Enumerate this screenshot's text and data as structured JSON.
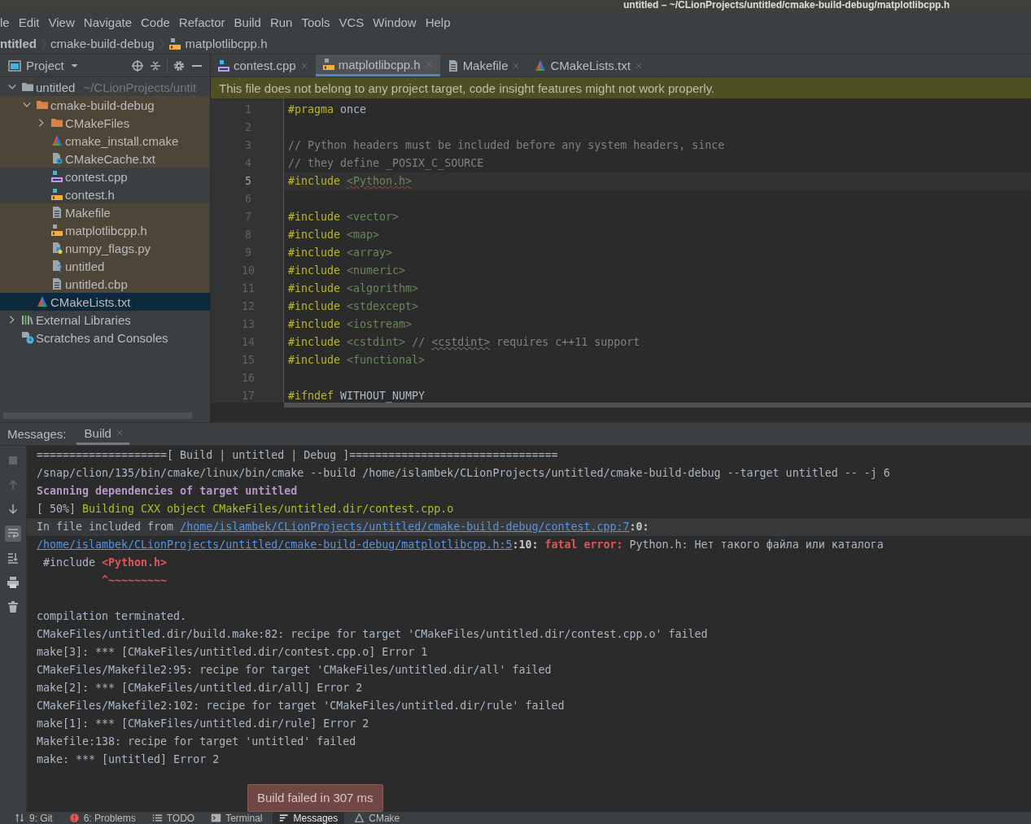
{
  "window": {
    "title": "untitled – ~/CLionProjects/untitled/cmake-build-debug/matplotlibcpp.h"
  },
  "menu": [
    "le",
    "Edit",
    "View",
    "Navigate",
    "Code",
    "Refactor",
    "Build",
    "Run",
    "Tools",
    "VCS",
    "Window",
    "Help"
  ],
  "breadcrumbs": [
    {
      "label": "ntitled",
      "kind": "project"
    },
    {
      "label": "cmake-build-debug",
      "kind": "folder"
    },
    {
      "label": "matplotlibcpp.h",
      "kind": "file"
    }
  ],
  "project_panel": {
    "title": "Project",
    "tree": [
      {
        "label": "untitled",
        "hint": "~/CLionProjects/untit",
        "kind": "folder",
        "expanded": true,
        "excluded": false,
        "selected": false,
        "children": [
          {
            "label": "cmake-build-debug",
            "kind": "build-folder",
            "expanded": true,
            "excluded": true,
            "selected": false,
            "children": [
              {
                "label": "CMakeFiles",
                "kind": "build-folder",
                "expanded": false,
                "excluded": true,
                "selected": false
              },
              {
                "label": "cmake_install.cmake",
                "kind": "cmake",
                "excluded": true,
                "selected": false
              },
              {
                "label": "CMakeCache.txt",
                "kind": "settings",
                "excluded": true,
                "selected": false
              },
              {
                "label": "contest.cpp",
                "kind": "cpp",
                "excluded": false,
                "selected": false
              },
              {
                "label": "contest.h",
                "kind": "header",
                "excluded": false,
                "selected": false
              },
              {
                "label": "Makefile",
                "kind": "text",
                "excluded": true,
                "selected": false
              },
              {
                "label": "matplotlibcpp.h",
                "kind": "foreign-header",
                "excluded": true,
                "selected": false
              },
              {
                "label": "numpy_flags.py",
                "kind": "script",
                "excluded": true,
                "selected": false
              },
              {
                "label": "untitled",
                "kind": "unknown",
                "excluded": true,
                "selected": false
              },
              {
                "label": "untitled.cbp",
                "kind": "text",
                "excluded": true,
                "selected": false
              }
            ]
          },
          {
            "label": "CMakeLists.txt",
            "kind": "cmake",
            "excluded": false,
            "selected": true
          }
        ]
      },
      {
        "label": "External Libraries",
        "kind": "libraries",
        "expanded": false,
        "excluded": false,
        "selected": false
      },
      {
        "label": "Scratches and Consoles",
        "kind": "scratches",
        "excluded": false,
        "selected": false
      }
    ]
  },
  "editor": {
    "tabs": [
      {
        "label": "contest.cpp",
        "kind": "cpp",
        "selected": false
      },
      {
        "label": "matplotlibcpp.h",
        "kind": "foreign-header",
        "selected": true
      },
      {
        "label": "Makefile",
        "kind": "text",
        "selected": false
      },
      {
        "label": "CMakeLists.txt",
        "kind": "cmake",
        "selected": false
      }
    ],
    "notice": "This file does not belong to any project target, code insight features might not work properly.",
    "lines": [
      {
        "number": "1",
        "current": false,
        "segments": [
          {
            "kind": "directive",
            "text": "#pragma"
          },
          {
            "kind": "plain",
            "text": " once"
          }
        ]
      },
      {
        "number": "2",
        "current": false
      },
      {
        "number": "3",
        "current": false,
        "segments": [
          {
            "kind": "comment",
            "text": "// Python headers must be included before any system headers, since"
          }
        ]
      },
      {
        "number": "4",
        "current": false,
        "segments": [
          {
            "kind": "comment",
            "text": "// they define _POSIX_C_SOURCE"
          }
        ]
      },
      {
        "number": "5",
        "current": true,
        "segments": [
          {
            "kind": "directive",
            "text": "#include "
          },
          {
            "kind": "header-error",
            "text": "<Python.h>"
          }
        ]
      },
      {
        "number": "6",
        "current": false
      },
      {
        "number": "7",
        "current": false,
        "segments": [
          {
            "kind": "directive",
            "text": "#include "
          },
          {
            "kind": "header",
            "text": "<vector>"
          }
        ]
      },
      {
        "number": "8",
        "current": false,
        "segments": [
          {
            "kind": "directive",
            "text": "#include "
          },
          {
            "kind": "header",
            "text": "<map>"
          }
        ]
      },
      {
        "number": "9",
        "current": false,
        "segments": [
          {
            "kind": "directive",
            "text": "#include "
          },
          {
            "kind": "header",
            "text": "<array>"
          }
        ]
      },
      {
        "number": "10",
        "current": false,
        "segments": [
          {
            "kind": "directive",
            "text": "#include "
          },
          {
            "kind": "header",
            "text": "<numeric>"
          }
        ]
      },
      {
        "number": "11",
        "current": false,
        "segments": [
          {
            "kind": "directive",
            "text": "#include "
          },
          {
            "kind": "header",
            "text": "<algorithm>"
          }
        ]
      },
      {
        "number": "12",
        "current": false,
        "segments": [
          {
            "kind": "directive",
            "text": "#include "
          },
          {
            "kind": "header",
            "text": "<stdexcept>"
          }
        ]
      },
      {
        "number": "13",
        "current": false,
        "segments": [
          {
            "kind": "directive",
            "text": "#include "
          },
          {
            "kind": "header",
            "text": "<iostream>"
          }
        ]
      },
      {
        "number": "14",
        "current": false,
        "segments": [
          {
            "kind": "directive",
            "text": "#include "
          },
          {
            "kind": "header",
            "text": "<cstdint>"
          },
          {
            "kind": "comment",
            "text": " // "
          },
          {
            "kind": "comment-typo",
            "text": "<cstdint>"
          },
          {
            "kind": "comment",
            "text": " requires c++11 support"
          }
        ]
      },
      {
        "number": "15",
        "current": false,
        "segments": [
          {
            "kind": "directive",
            "text": "#include "
          },
          {
            "kind": "header",
            "text": "<functional>"
          }
        ]
      },
      {
        "number": "16",
        "current": false
      },
      {
        "number": "17",
        "current": false,
        "segments": [
          {
            "kind": "directive",
            "text": "#ifndef"
          },
          {
            "kind": "plain",
            "text": " WITHOUT_NUMPY"
          }
        ]
      }
    ]
  },
  "messages": {
    "label": "Messages:",
    "tabs": [
      {
        "label": "Build",
        "selected": true
      }
    ],
    "toolbar": [
      {
        "kind": "stop",
        "disabled": true
      },
      {
        "kind": "up",
        "disabled": true
      },
      {
        "kind": "down",
        "disabled": false
      },
      {
        "kind": "wrap",
        "disabled": false,
        "selected": true
      },
      {
        "kind": "scroll",
        "disabled": false,
        "selected": false
      },
      {
        "kind": "print",
        "disabled": false
      },
      {
        "kind": "trash",
        "disabled": false
      }
    ],
    "lines": [
      {
        "kind": "text",
        "highlighted": false,
        "segments": [
          {
            "kind": "plain",
            "text": "====================[ Build | untitled | Debug ]================================"
          }
        ]
      },
      {
        "kind": "text",
        "highlighted": false,
        "segments": [
          {
            "kind": "plain",
            "text": "/snap/clion/135/bin/cmake/linux/bin/cmake --build /home/islambek/CLionProjects/untitled/cmake-build-debug --target untitled -- -j 6"
          }
        ]
      },
      {
        "kind": "text",
        "highlighted": false,
        "segments": [
          {
            "kind": "purple",
            "text": "Scanning dependencies of target untitled"
          }
        ]
      },
      {
        "kind": "text",
        "highlighted": false,
        "segments": [
          {
            "kind": "plain",
            "text": "[ 50%] "
          },
          {
            "kind": "green",
            "text": "Building CXX object CMakeFiles/untitled.dir/contest.cpp.o"
          }
        ]
      },
      {
        "kind": "text",
        "highlighted": true,
        "segments": [
          {
            "kind": "plain",
            "text": "In file included from "
          },
          {
            "kind": "link",
            "text": "/home/islambek/CLionProjects/untitled/cmake-build-debug/contest.cpp:7"
          },
          {
            "kind": "bold",
            "text": ":0:"
          }
        ]
      },
      {
        "kind": "text",
        "highlighted": false,
        "segments": [
          {
            "kind": "link",
            "text": "/home/islambek/CLionProjects/untitled/cmake-build-debug/matplotlibcpp.h:5"
          },
          {
            "kind": "bold",
            "text": ":10: "
          },
          {
            "kind": "error",
            "text": "fatal error:"
          },
          {
            "kind": "plain",
            "text": " Python.h: Нет такого файла или каталога"
          }
        ]
      },
      {
        "kind": "text",
        "highlighted": false,
        "segments": [
          {
            "kind": "plain",
            "text": " #include "
          },
          {
            "kind": "error",
            "text": "<Python.h>"
          }
        ]
      },
      {
        "kind": "marker",
        "highlighted": false,
        "segments": [
          {
            "kind": "error",
            "text": "^~~~~~~~~~"
          }
        ]
      },
      {
        "kind": "blank",
        "highlighted": false
      },
      {
        "kind": "text",
        "highlighted": false,
        "segments": [
          {
            "kind": "plain",
            "text": "compilation terminated."
          }
        ]
      },
      {
        "kind": "text",
        "highlighted": false,
        "segments": [
          {
            "kind": "plain",
            "text": "CMakeFiles/untitled.dir/build.make:82: recipe for target 'CMakeFiles/untitled.dir/contest.cpp.o' failed"
          }
        ]
      },
      {
        "kind": "text",
        "highlighted": false,
        "segments": [
          {
            "kind": "plain",
            "text": "make[3]: *** [CMakeFiles/untitled.dir/contest.cpp.o] Error 1"
          }
        ]
      },
      {
        "kind": "text",
        "highlighted": false,
        "segments": [
          {
            "kind": "plain",
            "text": "CMakeFiles/Makefile2:95: recipe for target 'CMakeFiles/untitled.dir/all' failed"
          }
        ]
      },
      {
        "kind": "text",
        "highlighted": false,
        "segments": [
          {
            "kind": "plain",
            "text": "make[2]: *** [CMakeFiles/untitled.dir/all] Error 2"
          }
        ]
      },
      {
        "kind": "text",
        "highlighted": false,
        "segments": [
          {
            "kind": "plain",
            "text": "CMakeFiles/Makefile2:102: recipe for target 'CMakeFiles/untitled.dir/rule' failed"
          }
        ]
      },
      {
        "kind": "text",
        "highlighted": false,
        "segments": [
          {
            "kind": "plain",
            "text": "make[1]: *** [CMakeFiles/untitled.dir/rule] Error 2"
          }
        ]
      },
      {
        "kind": "text",
        "highlighted": false,
        "segments": [
          {
            "kind": "plain",
            "text": "Makefile:138: recipe for target 'untitled' failed"
          }
        ]
      },
      {
        "kind": "text",
        "highlighted": false,
        "segments": [
          {
            "kind": "plain",
            "text": "make: *** [untitled] Error 2"
          }
        ]
      }
    ]
  },
  "notification": "Build failed in 307 ms",
  "tool_windows": [
    {
      "label": "9: Git",
      "kind": "git",
      "selected": false
    },
    {
      "label": "6: Problems",
      "kind": "problems",
      "selected": false
    },
    {
      "label": "TODO",
      "kind": "list",
      "selected": false
    },
    {
      "label": "Terminal",
      "kind": "terminal",
      "selected": false
    },
    {
      "label": "Messages",
      "kind": "messages",
      "selected": true
    },
    {
      "label": "CMake",
      "kind": "cmake-outline",
      "selected": false
    }
  ]
}
